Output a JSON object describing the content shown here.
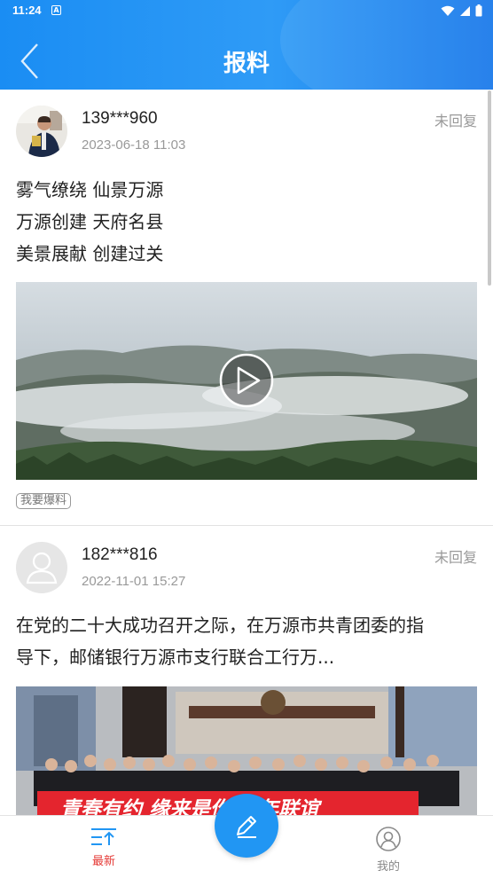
{
  "status_bar": {
    "time": "11:24",
    "app_icon_letter": "A"
  },
  "header": {
    "title": "报料"
  },
  "posts": [
    {
      "user": "139***960",
      "time": "2023-06-18 11:03",
      "reply_status": "未回复",
      "lines": [
        "雾气缭绕 仙景万源",
        "万源创建 天府名县",
        "美景展献 创建过关"
      ],
      "media_type": "video",
      "tag": "我要爆料"
    },
    {
      "user": "182***816",
      "time": "2022-11-01 15:27",
      "reply_status": "未回复",
      "lines": [
        "在党的二十大成功召开之际，在万源市共青团委的指",
        "导下，邮储银行万源市支行联合工行万..."
      ],
      "media_type": "image",
      "banner_text": "青春有约 缘来是你 青年联谊"
    }
  ],
  "bottom_nav": {
    "items": [
      {
        "label": "最新",
        "active": true
      },
      {
        "label": "我的",
        "active": false
      }
    ]
  },
  "colors": {
    "accent": "#1a8df3",
    "active_tab": "#e53935",
    "fab": "#2196f3"
  }
}
